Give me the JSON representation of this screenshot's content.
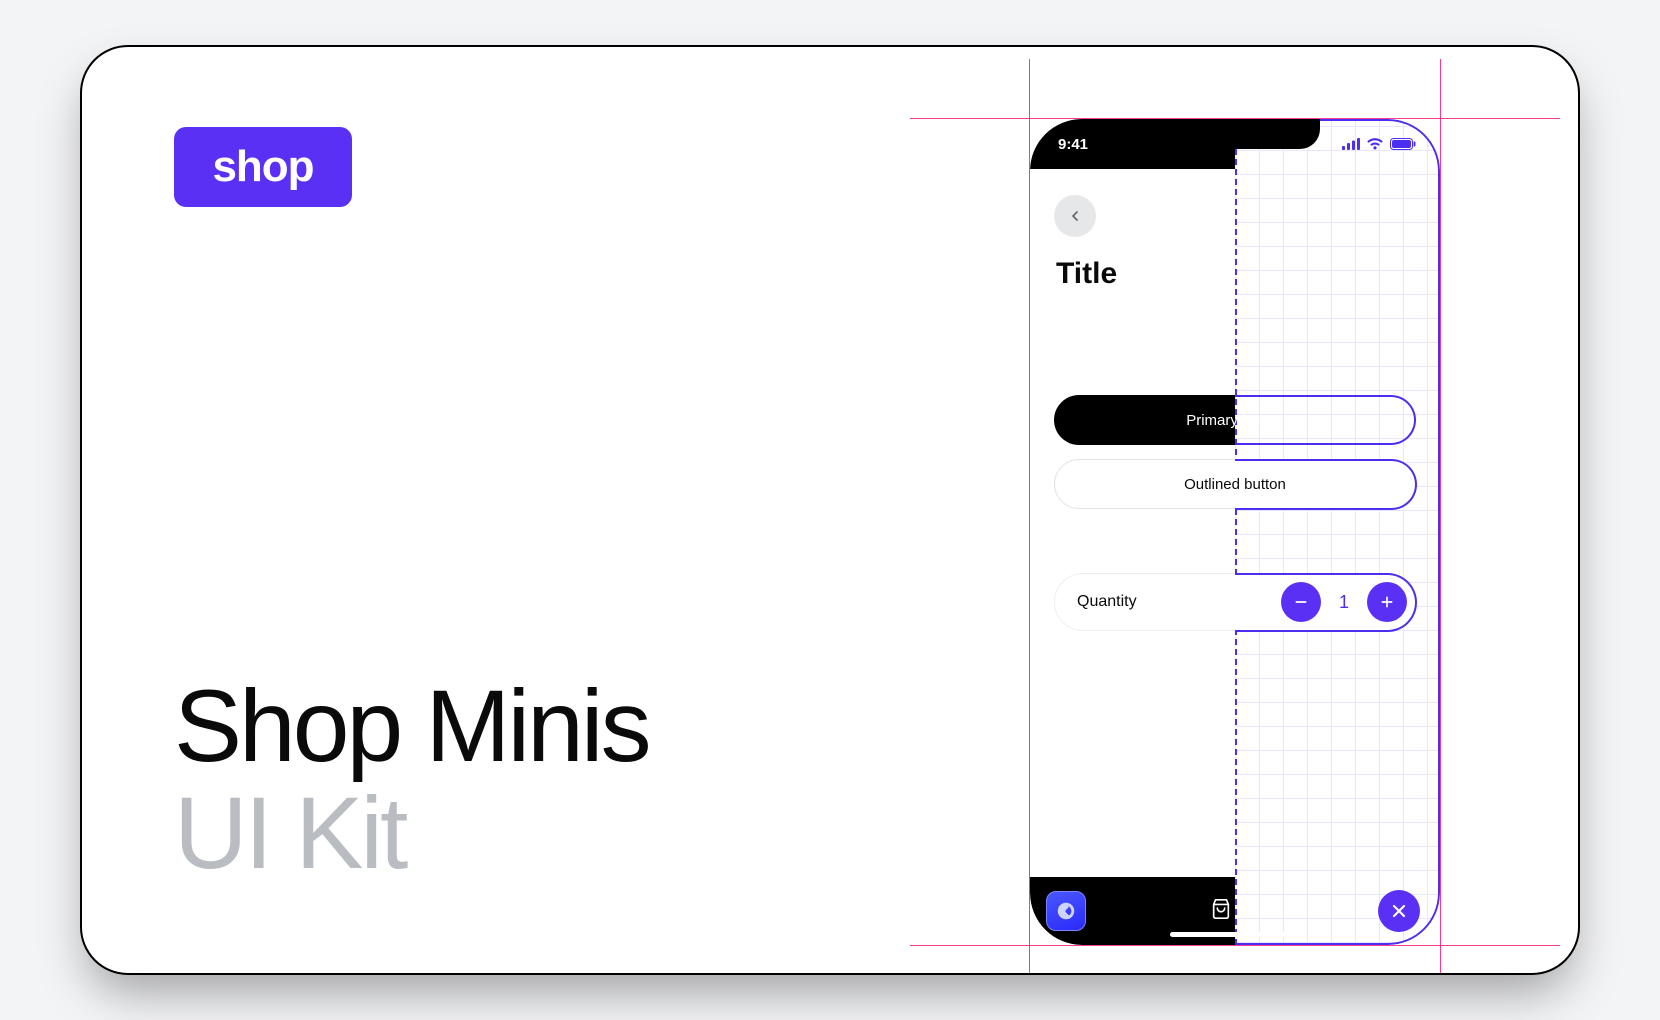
{
  "brand": {
    "badge_text": "shop"
  },
  "headline": {
    "line1": "Shop Minis",
    "line2": "UI Kit"
  },
  "accent_color": "#5a31f4",
  "blueprint_color": "#4A2FF0",
  "phone": {
    "status_time": "9:41",
    "back_label": "Back",
    "screen_title": "Title",
    "buttons": {
      "primary": "Primary button",
      "outlined": "Outlined button"
    },
    "quantity": {
      "label": "Quantity",
      "value": "1"
    },
    "bottom": {
      "close_label": "Close"
    }
  }
}
